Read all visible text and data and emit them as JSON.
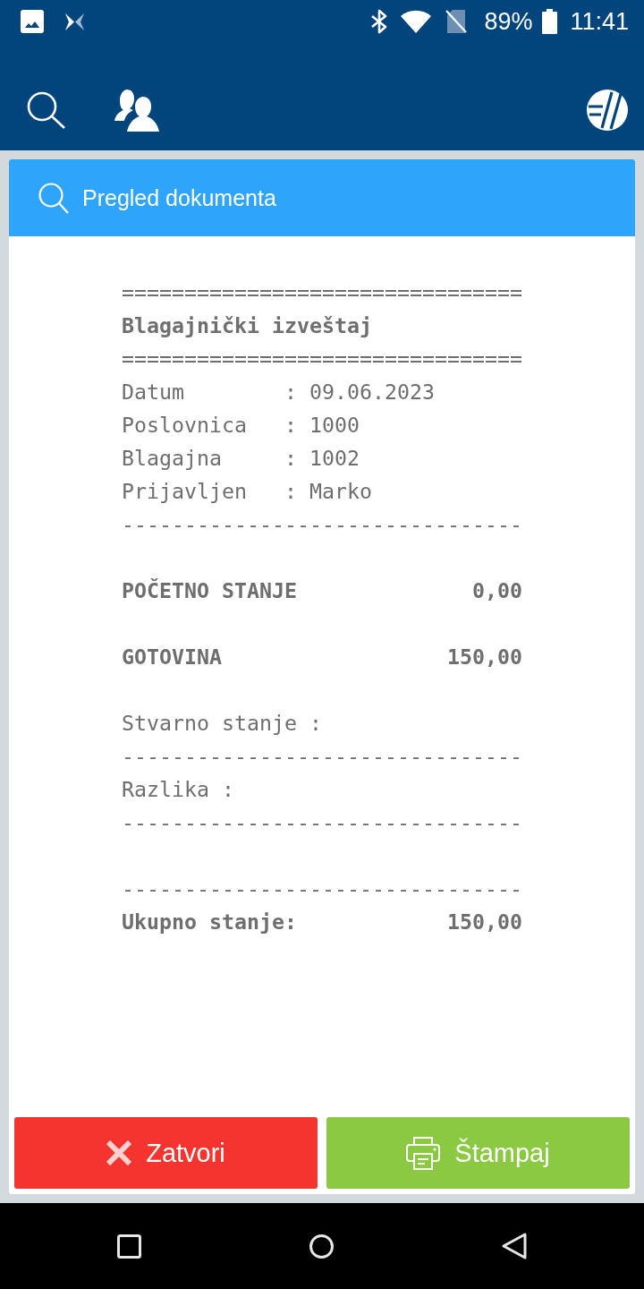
{
  "status_bar": {
    "battery": "89%",
    "time": "11:41"
  },
  "panel": {
    "title": "Pregled dokumenta"
  },
  "receipt": {
    "lines": [
      {
        "kind": "rule",
        "text": "================================"
      },
      {
        "kind": "title",
        "text": "Blagajnički izveštaj"
      },
      {
        "kind": "rule",
        "text": "================================"
      },
      {
        "kind": "field",
        "label": "Datum",
        "separator": ":",
        "value": "09.06.2023"
      },
      {
        "kind": "field",
        "label": "Poslovnica",
        "separator": ":",
        "value": "1000"
      },
      {
        "kind": "field",
        "label": "Blagajna",
        "separator": ":",
        "value": "1002"
      },
      {
        "kind": "field",
        "label": "Prijavljen",
        "separator": ":",
        "value": "Marko"
      },
      {
        "kind": "rule",
        "text": "--------------------------------"
      },
      {
        "kind": "blank"
      },
      {
        "kind": "amount",
        "label": "POČETNO STANJE",
        "value": "0,00"
      },
      {
        "kind": "blank"
      },
      {
        "kind": "amount",
        "label": "GOTOVINA",
        "value": "150,00"
      },
      {
        "kind": "blank"
      },
      {
        "kind": "text",
        "text": "Stvarno stanje :"
      },
      {
        "kind": "rule",
        "text": "--------------------------------"
      },
      {
        "kind": "text",
        "text": "Razlika :"
      },
      {
        "kind": "rule",
        "text": "--------------------------------"
      },
      {
        "kind": "blank"
      },
      {
        "kind": "rule",
        "text": "--------------------------------"
      },
      {
        "kind": "amount",
        "label": "Ukupno stanje:",
        "value": "150,00"
      }
    ]
  },
  "buttons": [
    {
      "kind": "close",
      "label": "Zatvori"
    },
    {
      "kind": "print",
      "label": "Štampaj"
    }
  ]
}
